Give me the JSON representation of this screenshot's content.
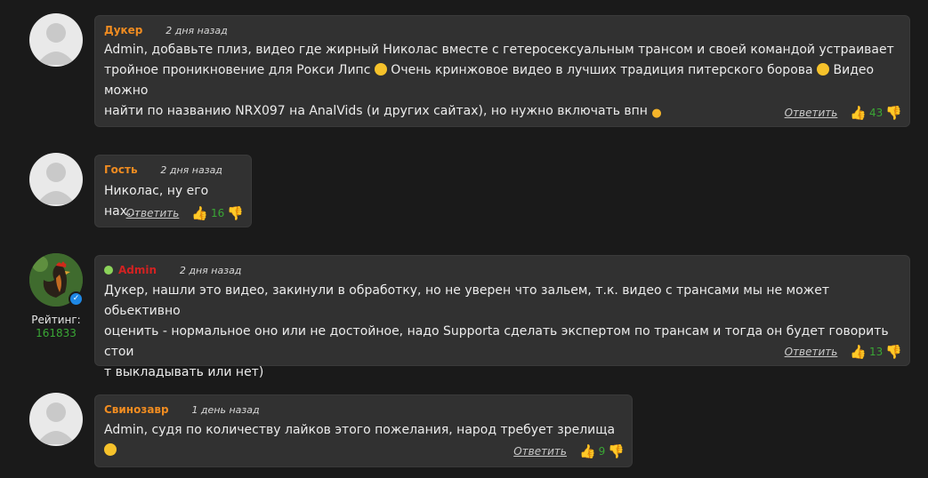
{
  "comments": [
    {
      "author": "Дукер",
      "time": "2 дня назад",
      "text_parts": [
        "Admin, добавьте плиз, видео где жирный Николас вместе с гетеросексуальным трансом и своей командой устраивает тро",
        "йное проникновение для Рокси Липс ",
        " Очень кринжовое видео в лучших традиция питерского борова ",
        " Видео можно",
        "найти по названию NRX097 на AnalVids (и других сайтах), но нужно включать впн "
      ],
      "reply_label": "Ответить",
      "likes": "43"
    },
    {
      "author": "Гость",
      "time": "2 дня назад",
      "text": "Николас, ну его нах...",
      "reply_label": "Ответить",
      "likes": "16"
    },
    {
      "author": "Admin",
      "time": "2 дня назад",
      "rating_label": "Рейтинг:",
      "rating_value": "161833",
      "text_lines": [
        "Дукер, нашли это видео, закинули в обработку, но не уверен что зальем, т.к. видео с трансами мы не может обьективно",
        "оценить - нормальное оно или не достойное, надо Supporta сделать экспертом по трансам и тогда он будет говорить стои",
        "т выкладывать или нет)"
      ],
      "reply_label": "Ответить",
      "likes": "13"
    },
    {
      "author": "Свинозавр",
      "time": "1 день назад",
      "text": "Admin, судя по количеству лайков этого пожелания, народ требует зрелища ",
      "reply_label": "Ответить",
      "likes": "9"
    }
  ],
  "colors": {
    "author": "#f08c21",
    "admin": "#d32222",
    "likes": "#3aa735",
    "bubble": "#313131",
    "background": "#1a1a1a"
  },
  "icons": [
    "user-avatar-icon",
    "rooster-avatar-icon",
    "verified-icon",
    "thumbs-up-icon",
    "thumbs-down-icon",
    "grinning-emoji-icon",
    "flexed-arm-emoji-icon",
    "online-status-icon"
  ]
}
